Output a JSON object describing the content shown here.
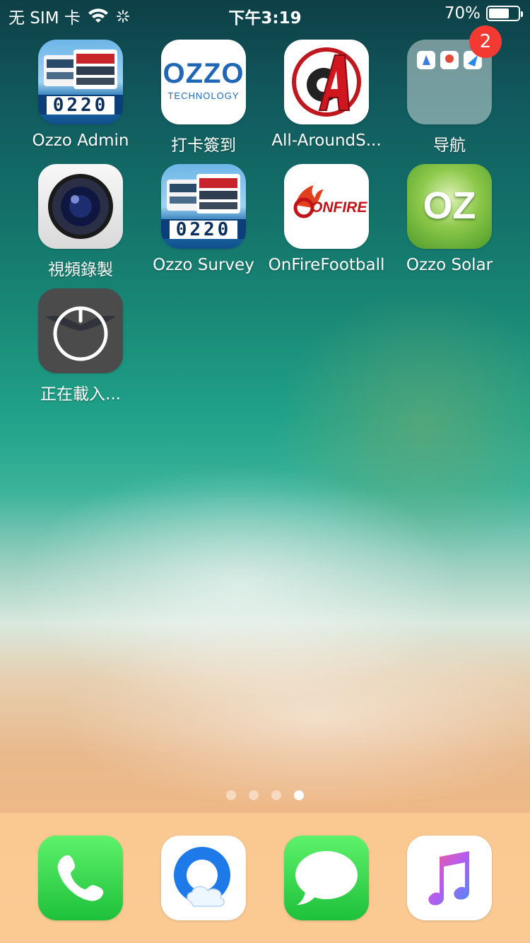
{
  "status_bar": {
    "carrier": "无 SIM 卡",
    "time": "下午3:19",
    "battery_text": "70%",
    "battery_level": 0.7
  },
  "apps": [
    {
      "label": "Ozzo Admin",
      "icon": "bus-0220-icon"
    },
    {
      "label": "打卡簽到",
      "icon": "ozzo-technology-icon",
      "icon_text_1": "OZZO",
      "icon_text_2": "TECHNOLOGY"
    },
    {
      "label": "All-AroundS...",
      "icon": "all-around-soccer-icon"
    },
    {
      "label": "导航",
      "icon": "folder-navigation-icon",
      "badge": "2"
    },
    {
      "label": "視頻錄製",
      "icon": "camera-lens-icon"
    },
    {
      "label": "Ozzo Survey",
      "icon": "bus-0220-icon"
    },
    {
      "label": "OnFireFootball",
      "icon": "onfire-icon",
      "icon_text": "ONFIRE"
    },
    {
      "label": "Ozzo Solar",
      "icon": "oz-solar-icon",
      "icon_text": "OZ"
    },
    {
      "label": "正在載入...",
      "icon": "loading-app-icon"
    }
  ],
  "bus_number": "0220",
  "page_dots": {
    "count": 4,
    "active_index": 3
  },
  "dock": [
    {
      "label": "Phone",
      "icon": "phone-icon"
    },
    {
      "label": "QQ Browser",
      "icon": "qq-browser-icon"
    },
    {
      "label": "Messages",
      "icon": "messages-icon"
    },
    {
      "label": "Music",
      "icon": "music-icon"
    }
  ],
  "colors": {
    "badge": "#f23a32",
    "phone_green": "#2ecf4f",
    "dock_bg": "#fdcd96"
  }
}
